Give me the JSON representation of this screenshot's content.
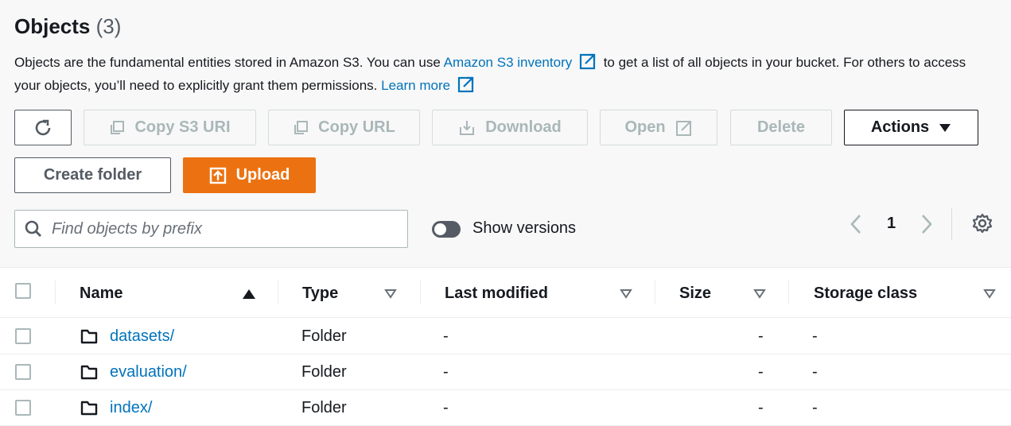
{
  "header": {
    "title": "Objects",
    "count": "(3)"
  },
  "description": {
    "text1": "Objects are the fundamental entities stored in Amazon S3. You can use ",
    "link1": "Amazon S3 inventory",
    "text2": "to get a list of all objects in your bucket. For others to access your objects, you’ll need to explicitly grant them permissions.",
    "link2": "Learn more"
  },
  "toolbar": {
    "copy_s3_uri": "Copy S3 URI",
    "copy_url": "Copy URL",
    "download": "Download",
    "open": "Open",
    "delete": "Delete",
    "actions": "Actions",
    "create_folder": "Create folder",
    "upload": "Upload"
  },
  "search": {
    "placeholder": "Find objects by prefix",
    "value": ""
  },
  "versions": {
    "label": "Show versions",
    "enabled": false
  },
  "pagination": {
    "page": "1"
  },
  "table": {
    "columns": [
      "Name",
      "Type",
      "Last modified",
      "Size",
      "Storage class"
    ],
    "rows": [
      {
        "name": "datasets/",
        "type": "Folder",
        "last_modified": "-",
        "size": "-",
        "storage_class": "-"
      },
      {
        "name": "evaluation/",
        "type": "Folder",
        "last_modified": "-",
        "size": "-",
        "storage_class": "-"
      },
      {
        "name": "index/",
        "type": "Folder",
        "last_modified": "-",
        "size": "-",
        "storage_class": "-"
      }
    ]
  },
  "colors": {
    "link": "#0073bb",
    "primary": "#ec7211",
    "disabled_text": "#aab7b8",
    "text": "#16191f"
  },
  "icons": [
    "refresh-icon",
    "copy-icon",
    "download-icon",
    "external-link-icon",
    "caret-down-icon",
    "upload-icon",
    "search-icon",
    "chevron-left-icon",
    "chevron-right-icon",
    "settings-icon",
    "sort-ascending-icon",
    "sort-icon",
    "folder-icon"
  ]
}
